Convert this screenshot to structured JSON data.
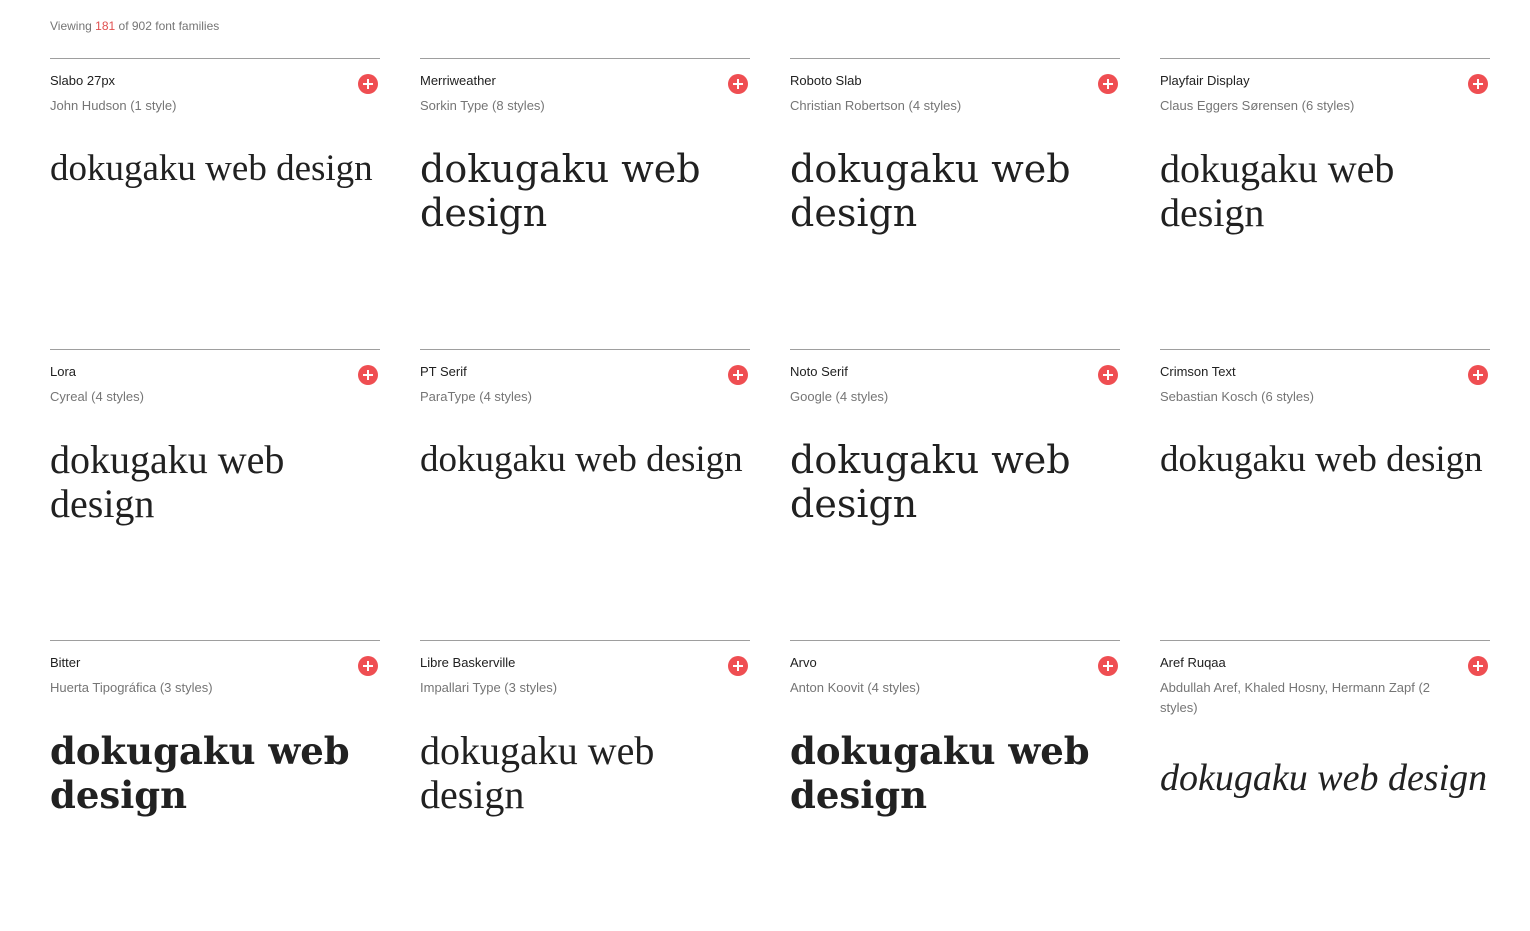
{
  "header": {
    "prefix": "Viewing",
    "shown": "181",
    "suffix": "of 902 font families"
  },
  "sample_text": "dokugaku web design",
  "accent_color": "#ef4e52",
  "add_icon": "plus-circle-icon",
  "fonts": [
    {
      "name": "Slabo 27px",
      "designer": "John Hudson (1 style)"
    },
    {
      "name": "Merriweather",
      "designer": "Sorkin Type (8 styles)"
    },
    {
      "name": "Roboto Slab",
      "designer": "Christian Robertson (4 styles)"
    },
    {
      "name": "Playfair Display",
      "designer": "Claus Eggers Sørensen (6 styles)"
    },
    {
      "name": "Lora",
      "designer": "Cyreal (4 styles)"
    },
    {
      "name": "PT Serif",
      "designer": "ParaType (4 styles)"
    },
    {
      "name": "Noto Serif",
      "designer": "Google (4 styles)"
    },
    {
      "name": "Crimson Text",
      "designer": "Sebastian Kosch (6 styles)"
    },
    {
      "name": "Bitter",
      "designer": "Huerta Tipográfica (3 styles)"
    },
    {
      "name": "Libre Baskerville",
      "designer": "Impallari Type (3 styles)"
    },
    {
      "name": "Arvo",
      "designer": "Anton Koovit (4 styles)"
    },
    {
      "name": "Aref Ruqaa",
      "designer": "Abdullah Aref, Khaled Hosny, Hermann Zapf (2 styles)"
    }
  ]
}
